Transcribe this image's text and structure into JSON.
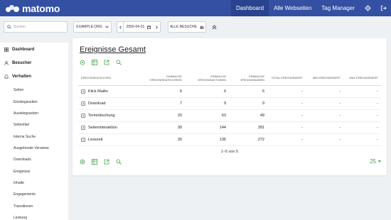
{
  "app": {
    "logo_text": "matomo",
    "brand_color": "#3450a3",
    "accent_green": "#43a047"
  },
  "topnav": {
    "items": [
      {
        "label": "Dashboard",
        "active": true
      },
      {
        "label": "Alle Webseiten",
        "active": false
      },
      {
        "label": "Tag Manager",
        "active": false
      }
    ],
    "icons": [
      "gear-icon",
      "logout-icon"
    ]
  },
  "controls": {
    "search_placeholder": "Suchen",
    "site": "EXAMPLE.ORG",
    "date": "2050-04-01",
    "segment": "ALLE BESUCHE"
  },
  "sidebar": {
    "sections": [
      {
        "label": "Dashboard",
        "icon": "grid-icon"
      },
      {
        "label": "Besucher",
        "icon": "user-icon"
      },
      {
        "label": "Verhalten",
        "icon": "bell-icon"
      }
    ],
    "items": [
      "Seiten",
      "Einstiegsseiten",
      "Ausstiegsseiten",
      "Seitentitel",
      "Interne Suche",
      "Ausgehende Verweise",
      "Downloads",
      "Ereignisse",
      "Inhalte",
      "Engagements",
      "Transitionen",
      "Leistung"
    ]
  },
  "report": {
    "title": "Ereignisse Gesamt",
    "columns": [
      "EREIGNISKATEGORIE",
      "EINMALIGE EREIGNISKATEGORIEN",
      "EINMALIGE EREIGNISAKTIONEN",
      "EINMALIGE EREIGNISNAMEN",
      "TOTAL EREIGNISWERT",
      "MIN EREIGNISWERT",
      "MAX EREIGNISWERT"
    ],
    "rows": [
      [
        "Klick Mailto",
        "6",
        "6",
        "6",
        "-",
        "-",
        "-"
      ],
      [
        "Download",
        "7",
        "9",
        "9",
        "-",
        "-",
        "-"
      ],
      [
        "Terminbuchung",
        "20",
        "63",
        "49",
        "-",
        "-",
        "-"
      ],
      [
        "Seiteninteraktion",
        "30",
        "144",
        "281",
        "-",
        "-",
        "-"
      ],
      [
        "Lesezeit",
        "30",
        "135",
        "272",
        "-",
        "-",
        "-"
      ]
    ],
    "pagination": "1–5 von 5",
    "limit": "25"
  }
}
